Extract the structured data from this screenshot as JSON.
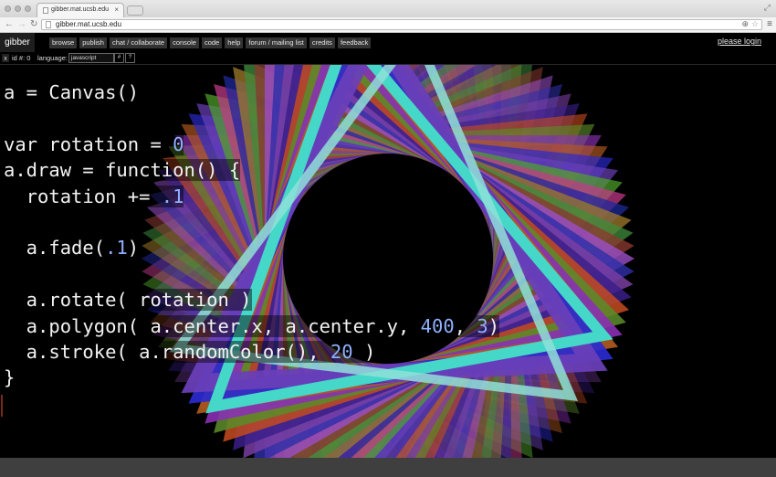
{
  "browser": {
    "tab_title": "gibber.mat.ucsb.edu",
    "url": "gibber.mat.ucsb.edu",
    "tab_close": "×",
    "icons": [
      "back-icon",
      "forward-icon",
      "reload-icon",
      "zoom-icon",
      "star-icon",
      "menu-icon"
    ]
  },
  "app": {
    "logo": "gibber",
    "menu": [
      "browse",
      "publish",
      "chat / collaborate",
      "console",
      "code",
      "help",
      "forum / mailing list",
      "credits",
      "feedback"
    ],
    "login": "please login"
  },
  "editor": {
    "close_label": "x",
    "id_label": "id #: 0",
    "language_label": "language:",
    "language_value": "javascript",
    "btn_hash": "#",
    "btn_help": "?"
  },
  "code_lines": [
    [
      {
        "t": "a = Canvas()",
        "c": "plain"
      }
    ],
    [],
    [
      {
        "t": "var rotation = ",
        "c": "plain"
      },
      {
        "t": "0",
        "c": "num"
      }
    ],
    [
      {
        "t": "a.draw = function() {",
        "c": "plain"
      }
    ],
    [
      {
        "t": "  rotation += ",
        "c": "plain"
      },
      {
        "t": ".1",
        "c": "num"
      }
    ],
    [],
    [
      {
        "t": "  a.fade(",
        "c": "plain"
      },
      {
        "t": ".1",
        "c": "num"
      },
      {
        "t": ")",
        "c": "plain"
      }
    ],
    [],
    [
      {
        "t": "  a.rotate( rotation )",
        "c": "plain"
      }
    ],
    [
      {
        "t": "  a.polygon( a.center.x, a.center.y, ",
        "c": "plain"
      },
      {
        "t": "400",
        "c": "num"
      },
      {
        "t": ", ",
        "c": "plain"
      },
      {
        "t": "3",
        "c": "num"
      },
      {
        "t": ")",
        "c": "plain"
      }
    ],
    [
      {
        "t": "  a.stroke( a.randomColor(), ",
        "c": "plain"
      },
      {
        "t": "20",
        "c": "num"
      },
      {
        "t": " )",
        "c": "plain"
      }
    ],
    [
      {
        "t": "}",
        "c": "plain"
      }
    ]
  ],
  "colors": {
    "accent": "#45d7c8",
    "number": "#8fb0ff",
    "palette": [
      "#7b3fa3",
      "#3a1f8a",
      "#c24a1f",
      "#5a8a2a",
      "#8a2fb5",
      "#b35a1f",
      "#2a2ad0",
      "#6a3fb8",
      "#4fa32a",
      "#c23a8a",
      "#1f2a9b",
      "#a07a2a",
      "#3f8a3a",
      "#8a3a2f",
      "#9a4fc8",
      "#2f2fa8"
    ]
  }
}
